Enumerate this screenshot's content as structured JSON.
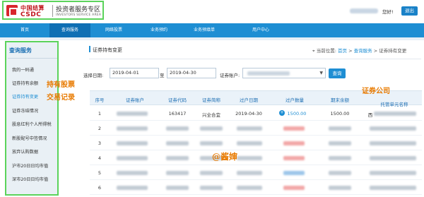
{
  "header": {
    "logo_cn": "中国结算",
    "logo_en": "CSDC",
    "zone_title": "投资者服务专区",
    "zone_sub": "INVESTORS SERVICE AREA",
    "greeting": "您好!",
    "logout": "退出"
  },
  "nav": {
    "items": [
      {
        "label": "首页"
      },
      {
        "label": "查询服务"
      },
      {
        "label": "网络投票"
      },
      {
        "label": "业务预约"
      },
      {
        "label": "业务预填单"
      },
      {
        "label": "用户中心"
      }
    ]
  },
  "sidebar": {
    "title": "查询服务",
    "items": [
      {
        "label": "我的一码通"
      },
      {
        "label": "证券持有余额"
      },
      {
        "label": "证券持有变更"
      },
      {
        "label": "证券冻结情况"
      },
      {
        "label": "股息红利个人所得税"
      },
      {
        "label": "新股配号中签情况"
      },
      {
        "label": "放弃认购数据"
      },
      {
        "label": "沪市20日日均市值"
      },
      {
        "label": "深市20日日均市值"
      }
    ]
  },
  "main": {
    "page_title": "证券持有变更",
    "breadcrumb": {
      "prefix": "当前位置:",
      "home": "首页",
      "sep": ">",
      "section": "查询服务",
      "current": "证券持有变更"
    },
    "filters": {
      "date_label": "选择日期:",
      "start_date": "2019-04-01",
      "to_label": "至",
      "end_date": "2019-04-30",
      "account_label": "证券账户:",
      "query_button": "查询"
    },
    "table": {
      "columns": [
        "序号",
        "证券账户",
        "证券代码",
        "证券简称",
        "过户日期",
        "过户数量",
        "期末余额",
        "托管单元名称"
      ],
      "rows": [
        {
          "index": "1",
          "code": "163417",
          "name": "兴全合宜",
          "date": "2019-04-30",
          "qty": "1500.00",
          "balance": "1500.00",
          "unit": "西"
        },
        {
          "index": "2"
        },
        {
          "index": "3"
        },
        {
          "index": "4"
        },
        {
          "index": "5"
        },
        {
          "index": "6"
        }
      ]
    }
  },
  "annotations": {
    "holdings_line1": "持有股票",
    "holdings_line2": "交易记录",
    "broker": "证券公司",
    "watermark": "@酱婶"
  }
}
